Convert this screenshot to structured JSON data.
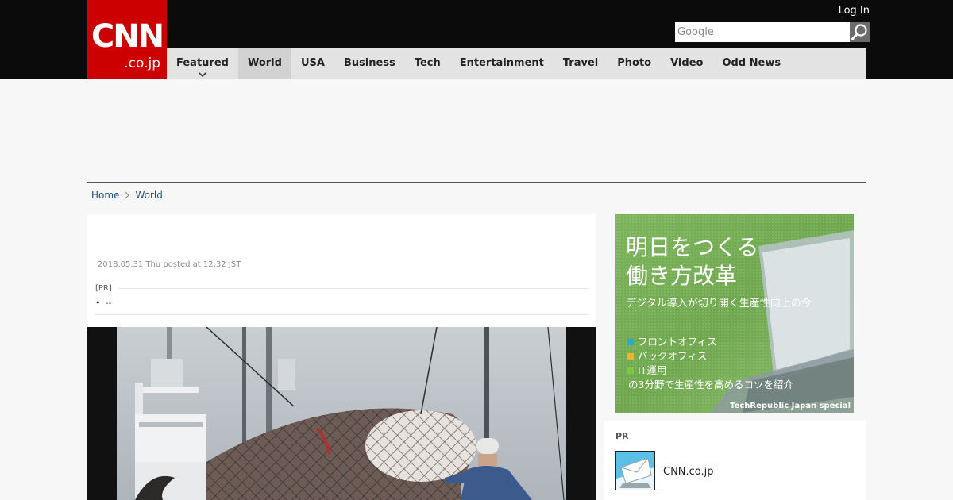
{
  "header": {
    "logo_text": "CNN",
    "logo_domain": ".co.jp",
    "login_label": "Log In",
    "search": {
      "placeholder": "Google",
      "value": ""
    },
    "icons": {
      "search": "search-icon",
      "dropdown": "chevron-down-icon"
    }
  },
  "nav": {
    "items": [
      {
        "label": "Featured",
        "has_dropdown": true
      },
      {
        "label": "World",
        "active": true
      },
      {
        "label": "USA"
      },
      {
        "label": "Business"
      },
      {
        "label": "Tech"
      },
      {
        "label": "Entertainment"
      },
      {
        "label": "Travel"
      },
      {
        "label": "Photo"
      },
      {
        "label": "Video"
      },
      {
        "label": "Odd News"
      }
    ]
  },
  "breadcrumb": {
    "home": "Home",
    "current": "World",
    "separator_icon": "chevron-right-icon"
  },
  "article": {
    "posted": "2018.05.31 Thu posted at 12:32 JST",
    "pr_label": "[PR]",
    "pr_link_text": "--",
    "image": "whale-hoisted-in-net-photo"
  },
  "side_banner": {
    "headline_1": "明日をつくる",
    "headline_2": "働き方改革",
    "subhead": "デジタル導入が切り開く生産性向上の今",
    "items": [
      {
        "label": "フロントオフィス",
        "color": "#2aa8d8"
      },
      {
        "label": "バックオフィス",
        "color": "#f0b429"
      },
      {
        "label": "IT運用",
        "color": "#7ac943"
      }
    ],
    "tail": "の3分野で生産性を高めるコツを紹介",
    "footer": "TechRepublic Japan special"
  },
  "pr_box": {
    "label": "PR",
    "item_text": "CNN.co.jp",
    "thumb_icon": "mail-thumbnail-icon"
  },
  "colors": {
    "brand_red": "#cc0000",
    "topbar": "#0b0b0c",
    "nav_bg": "#e3e3e3",
    "link": "#1a4f86",
    "banner_green": "#6aa84f"
  }
}
